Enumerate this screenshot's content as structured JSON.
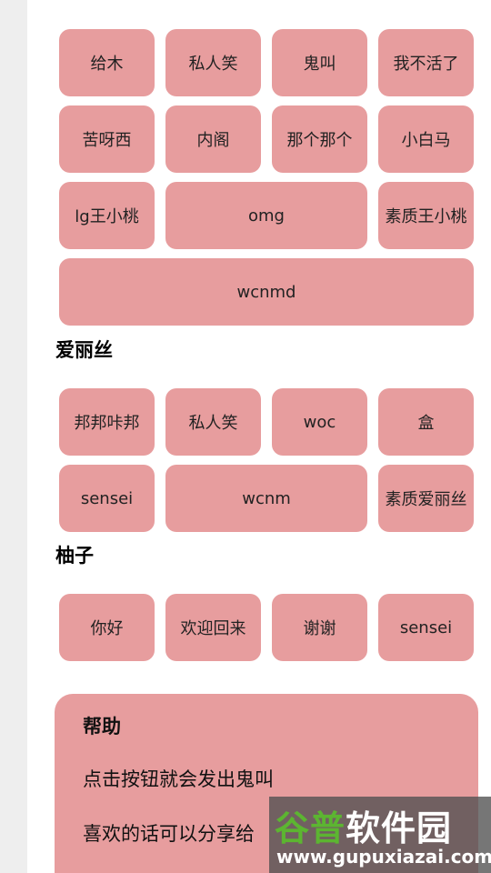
{
  "group1": {
    "buttons": [
      "给木",
      "私人笑",
      "鬼叫",
      "我不活了",
      "苦呀西",
      "内阁",
      "那个那个",
      "小白马",
      "lg王小桃",
      "omg",
      "素质王小桃",
      "wcnmd"
    ]
  },
  "group2": {
    "title": "爱丽丝",
    "buttons": [
      "邦邦咔邦",
      "私人笑",
      "woc",
      "盒",
      "sensei",
      "wcnm",
      "素质爱丽丝"
    ]
  },
  "group3": {
    "title": "柚子",
    "buttons": [
      "你好",
      "欢迎回来",
      "谢谢",
      "sensei"
    ]
  },
  "help": {
    "title": "帮助",
    "line1": "点击按钮就会发出鬼叫",
    "line2": "喜欢的话可以分享给"
  },
  "watermark": {
    "logo_part1": "谷普",
    "logo_part2": "软件园",
    "url": "www.gupuxiazai.com"
  },
  "colors": {
    "button_bg": "#e79d9e",
    "page_bg": "#ffffff",
    "side_bg": "#eeeeee",
    "watermark_green": "#5cb531"
  }
}
